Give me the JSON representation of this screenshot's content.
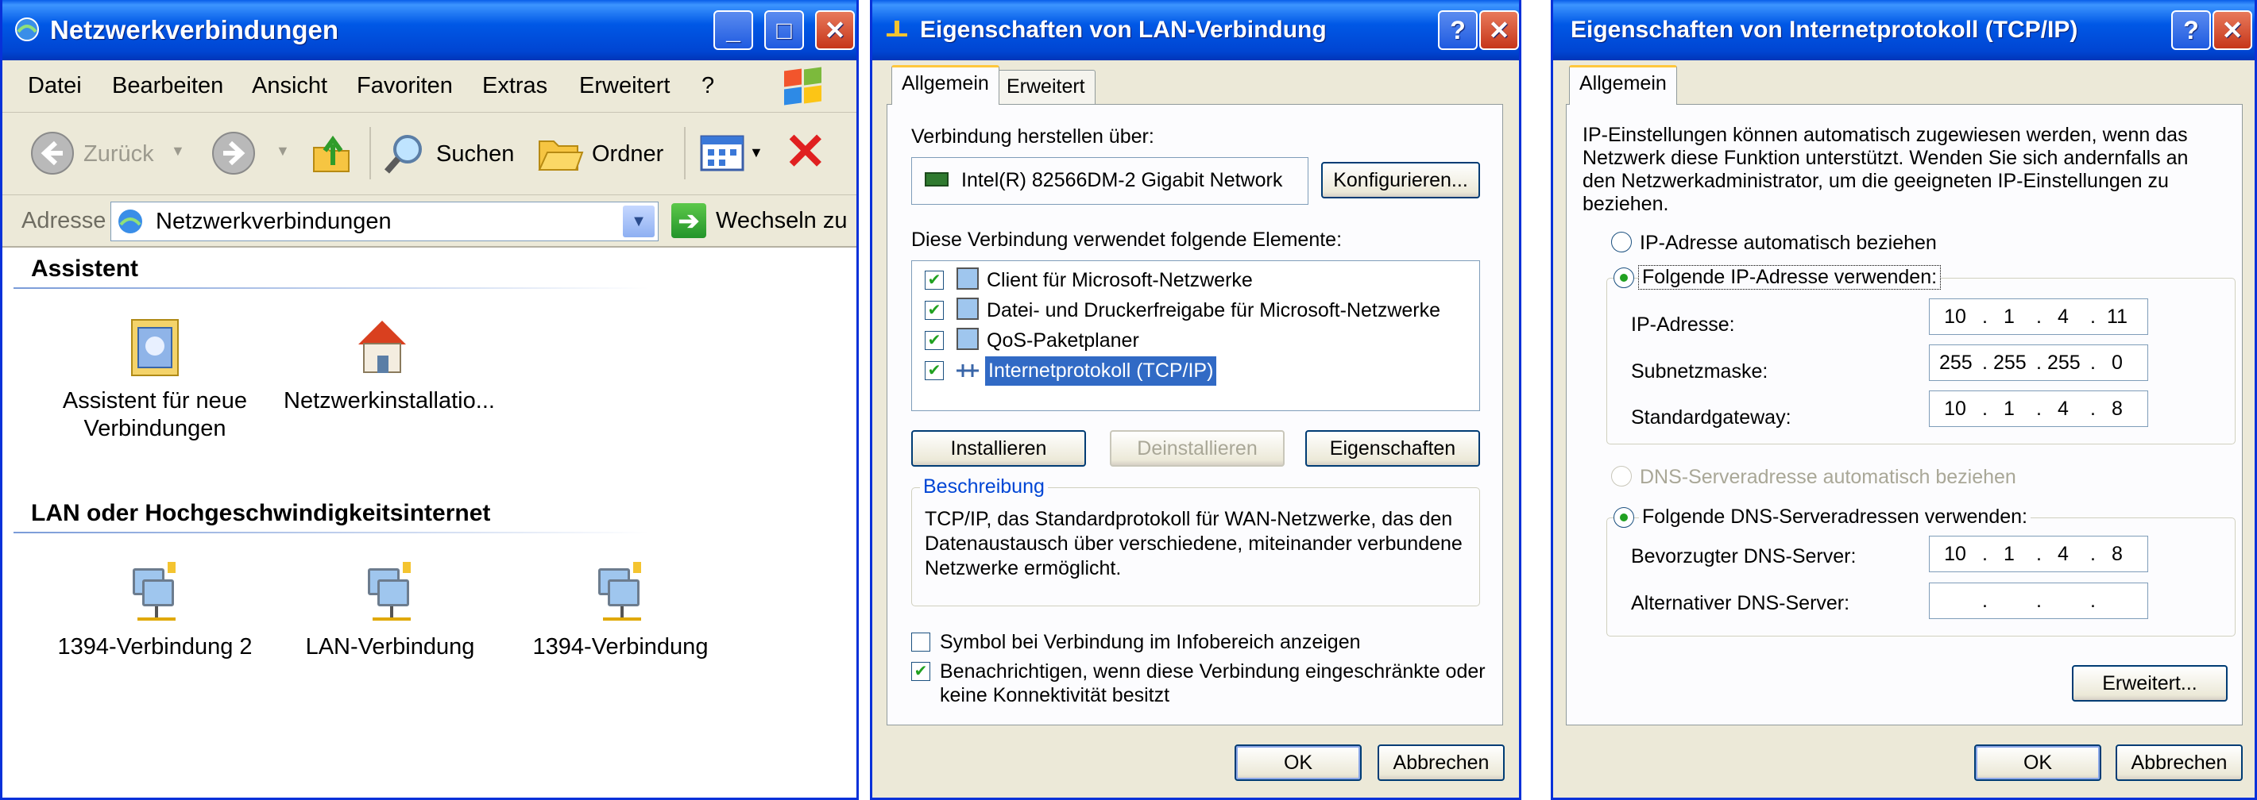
{
  "explorer": {
    "title": "Netzwerkverbindungen",
    "menu": [
      "Datei",
      "Bearbeiten",
      "Ansicht",
      "Favoriten",
      "Extras",
      "Erweitert",
      "?"
    ],
    "toolbar": {
      "back": "Zurück",
      "search": "Suchen",
      "folders": "Ordner"
    },
    "address": {
      "label": "Adresse",
      "value": "Netzwerkverbindungen",
      "go": "Wechseln zu"
    },
    "sections": [
      {
        "title": "Assistent",
        "items": [
          "Assistent für neue Verbindungen",
          "Netzwerkinstallatio..."
        ]
      },
      {
        "title": "LAN oder Hochgeschwindigkeitsinternet",
        "items": [
          "1394-Verbindung 2",
          "LAN-Verbindung",
          "1394-Verbindung"
        ]
      }
    ]
  },
  "lan": {
    "title": "Eigenschaften von LAN-Verbindung",
    "tabs": [
      "Allgemein",
      "Erweitert"
    ],
    "connect_label": "Verbindung herstellen über:",
    "adapter": "Intel(R) 82566DM-2 Gigabit Network",
    "configure": "Konfigurieren...",
    "elements_label": "Diese Verbindung verwendet folgende Elemente:",
    "elements": [
      {
        "label": "Client für Microsoft-Netzwerke",
        "checked": true
      },
      {
        "label": "Datei- und Druckerfreigabe für Microsoft-Netzwerke",
        "checked": true
      },
      {
        "label": "QoS-Paketplaner",
        "checked": true
      },
      {
        "label": "Internetprotokoll (TCP/IP)",
        "checked": true,
        "selected": true
      }
    ],
    "install": "Installieren",
    "uninstall": "Deinstallieren",
    "properties": "Eigenschaften",
    "description_title": "Beschreibung",
    "description": "TCP/IP, das Standardprotokoll für WAN-Netzwerke, das den Datenaustausch über verschiedene, miteinander verbundene Netzwerke ermöglicht.",
    "show_icon": "Symbol bei Verbindung im Infobereich anzeigen",
    "notify_line1": "Benachrichtigen, wenn diese Verbindung eingeschränkte oder",
    "notify_line2": "keine Konnektivität besitzt",
    "show_icon_checked": false,
    "notify_checked": true,
    "ok": "OK",
    "cancel": "Abbrechen"
  },
  "tcpip": {
    "title": "Eigenschaften von Internetprotokoll (TCP/IP)",
    "tab": "Allgemein",
    "intro": [
      "IP-Einstellungen können automatisch zugewiesen werden, wenn das",
      "Netzwerk diese Funktion unterstützt. Wenden Sie sich andernfalls an",
      "den Netzwerkadministrator, um die geeigneten IP-Einstellungen zu",
      "beziehen."
    ],
    "auto_ip": "IP-Adresse automatisch beziehen",
    "manual_ip": "Folgende IP-Adresse verwenden:",
    "ip_label": "IP-Adresse:",
    "ip": [
      "10",
      "1",
      "4",
      "11"
    ],
    "mask_label": "Subnetzmaske:",
    "mask": [
      "255",
      "255",
      "255",
      "0"
    ],
    "gw_label": "Standardgateway:",
    "gw": [
      "10",
      "1",
      "4",
      "8"
    ],
    "auto_dns": "DNS-Serveradresse automatisch beziehen",
    "manual_dns": "Folgende DNS-Serveradressen verwenden:",
    "dns1_label": "Bevorzugter DNS-Server:",
    "dns1": [
      "10",
      "1",
      "4",
      "8"
    ],
    "dns2_label": "Alternativer DNS-Server:",
    "dns2": [
      "",
      "",
      "",
      ""
    ],
    "advanced": "Erweitert...",
    "ok": "OK",
    "cancel": "Abbrechen"
  }
}
